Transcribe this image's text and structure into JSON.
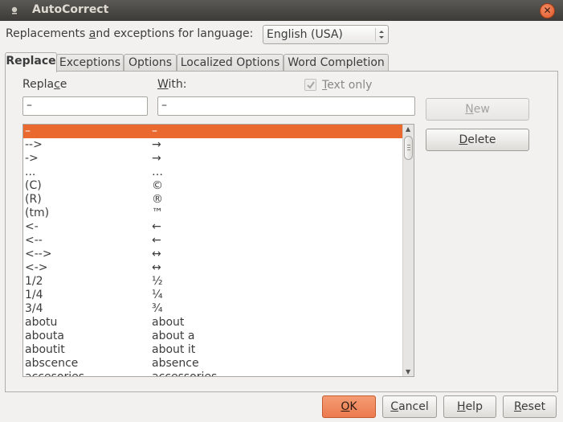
{
  "window": {
    "title": "AutoCorrect"
  },
  "language": {
    "label_pre": "Replacements ",
    "label_accel": "a",
    "label_post": "nd exceptions for language:",
    "selected": "English (USA)"
  },
  "tabs": [
    {
      "label": "Replace",
      "active": true
    },
    {
      "label": "Exceptions",
      "active": false
    },
    {
      "label": "Options",
      "active": false
    },
    {
      "label": "Localized Options",
      "active": false
    },
    {
      "label": "Word Completion",
      "active": false
    }
  ],
  "replace": {
    "replace_label_pre": "Repla",
    "replace_label_accel": "c",
    "replace_label_post": "e",
    "with_label_accel": "W",
    "with_label_post": "ith:",
    "text_only_accel": "T",
    "text_only_post": "ext only",
    "text_only_checked": true,
    "replace_value": "–",
    "with_value": "–",
    "new_accel": "N",
    "new_post": "ew",
    "delete_accel": "D",
    "delete_post": "elete"
  },
  "entries": [
    {
      "from": "–",
      "to": "–",
      "selected": true
    },
    {
      "from": "-->",
      "to": "→"
    },
    {
      "from": "->",
      "to": "→"
    },
    {
      "from": "...",
      "to": "…"
    },
    {
      "from": "(C)",
      "to": "©"
    },
    {
      "from": "(R)",
      "to": "®"
    },
    {
      "from": "(tm)",
      "to": "™"
    },
    {
      "from": "<-",
      "to": "←"
    },
    {
      "from": "<--",
      "to": "←"
    },
    {
      "from": "<-->",
      "to": "↔"
    },
    {
      "from": "<->",
      "to": "↔"
    },
    {
      "from": "1/2",
      "to": "½"
    },
    {
      "from": "1/4",
      "to": "¼"
    },
    {
      "from": "3/4",
      "to": "¾"
    },
    {
      "from": "abotu",
      "to": "about"
    },
    {
      "from": "abouta",
      "to": "about a"
    },
    {
      "from": "aboutit",
      "to": "about it"
    },
    {
      "from": "abscence",
      "to": "absence"
    },
    {
      "from": "accesories",
      "to": "accessories"
    }
  ],
  "footer": {
    "ok_accel": "O",
    "ok_post": "K",
    "cancel_accel": "C",
    "cancel_post": "ancel",
    "help_accel": "H",
    "help_post": "elp",
    "reset_accel": "R",
    "reset_post": "eset"
  }
}
